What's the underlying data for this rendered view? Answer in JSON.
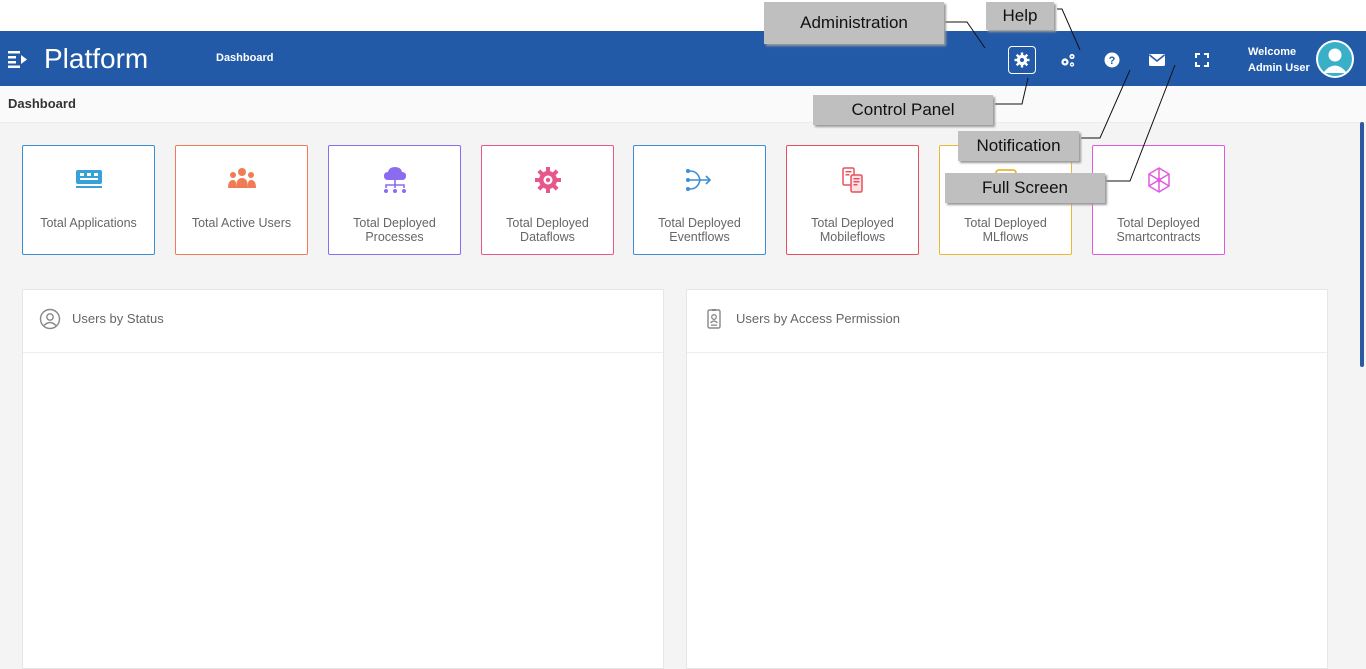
{
  "header": {
    "brand": "Platform",
    "breadcrumb": "Dashboard",
    "welcome_line1": "Welcome",
    "welcome_line2": "Admin User"
  },
  "breadcrumb_bar": {
    "title": "Dashboard"
  },
  "cards": [
    {
      "label": "Total Applications",
      "icon": "applications-icon",
      "color": "#3a8ed6"
    },
    {
      "label": "Total Active Users",
      "icon": "users-icon",
      "color": "#f07c55"
    },
    {
      "label": "Total Deployed Processes",
      "icon": "cloud-process-icon",
      "color": "#8b6bf0"
    },
    {
      "label": "Total Deployed Dataflows",
      "icon": "gear-dataflow-icon",
      "color": "#e8578c"
    },
    {
      "label": "Total Deployed Eventflows",
      "icon": "eventflow-icon",
      "color": "#3a8ed6"
    },
    {
      "label": "Total Deployed Mobileflows",
      "icon": "mobileflow-icon",
      "color": "#e8505b"
    },
    {
      "label": "Total Deployed MLflows",
      "icon": "mlflow-icon",
      "color": "#e8b830"
    },
    {
      "label": "Total Deployed Smartcontracts",
      "icon": "smartcontract-icon",
      "color": "#e05ae0"
    }
  ],
  "panels": [
    {
      "title": "Users by Status",
      "icon": "user-circle-icon"
    },
    {
      "title": "Users by Access Permission",
      "icon": "id-badge-icon"
    }
  ],
  "callouts": {
    "administration": "Administration",
    "help": "Help",
    "control_panel": "Control Panel",
    "notification": "Notification",
    "full_screen": "Full Screen"
  }
}
